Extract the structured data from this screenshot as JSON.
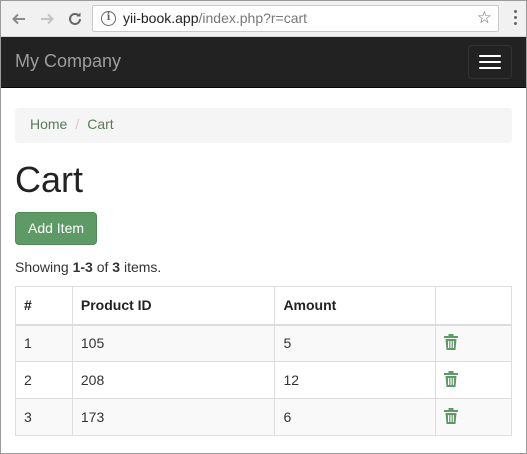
{
  "browser": {
    "url_host": "yii-book.app",
    "url_path": "/index.php?r=cart",
    "info_glyph": "i",
    "star_glyph": "☆"
  },
  "navbar": {
    "brand": "My Company"
  },
  "breadcrumb": {
    "home": "Home",
    "separator": "/",
    "current": "Cart"
  },
  "page": {
    "title": "Cart",
    "add_button": "Add Item"
  },
  "summary": {
    "prefix": "Showing ",
    "range": "1-3",
    "middle": " of ",
    "total": "3",
    "suffix": " items."
  },
  "table": {
    "headers": [
      "#",
      "Product ID",
      "Amount",
      ""
    ],
    "rows": [
      {
        "num": "1",
        "product_id": "105",
        "amount": "5"
      },
      {
        "num": "2",
        "product_id": "208",
        "amount": "12"
      },
      {
        "num": "3",
        "product_id": "173",
        "amount": "6"
      }
    ]
  },
  "colors": {
    "accent": "#5e9a66",
    "navbar": "#222222",
    "link": "#5a7b5a"
  },
  "icons": {
    "row_action": "trash-icon"
  }
}
